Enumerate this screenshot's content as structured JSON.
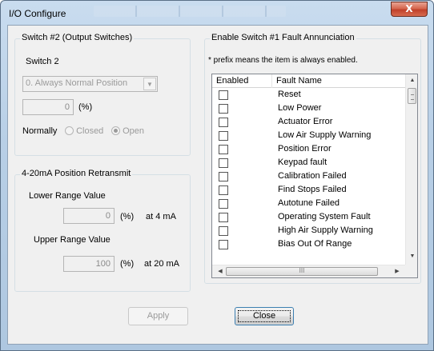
{
  "window": {
    "title": "I/O Configure",
    "close_glyph": "X"
  },
  "switch_group": {
    "legend": "Switch #2 (Output Switches)",
    "switch_label": "Switch 2",
    "mode_select": "0. Always Normal Position",
    "value": "0",
    "value_unit": "(%)",
    "normally_label": "Normally",
    "closed_label": "Closed",
    "open_label": "Open",
    "selected": "Open"
  },
  "retransmit_group": {
    "legend": "4-20mA Position Retransmit",
    "lower_label": "Lower Range Value",
    "lower_value": "0",
    "lower_unit": "(%)",
    "lower_suffix": "at 4 mA",
    "upper_label": "Upper Range Value",
    "upper_value": "100",
    "upper_unit": "(%)",
    "upper_suffix": "at 20 mA"
  },
  "fault_group": {
    "legend": "Enable Switch #1 Fault Annunciation",
    "note": "* prefix means the item is always enabled.",
    "columns": [
      "Enabled",
      "Fault Name"
    ],
    "rows": [
      {
        "name": "Reset",
        "enabled": false
      },
      {
        "name": "Low Power",
        "enabled": false
      },
      {
        "name": "Actuator Error",
        "enabled": false
      },
      {
        "name": "Low Air Supply Warning",
        "enabled": false
      },
      {
        "name": "Position Error",
        "enabled": false
      },
      {
        "name": "Keypad fault",
        "enabled": false
      },
      {
        "name": "Calibration Failed",
        "enabled": false
      },
      {
        "name": "Find Stops Failed",
        "enabled": false
      },
      {
        "name": "Autotune Failed",
        "enabled": false
      },
      {
        "name": "Operating System Fault",
        "enabled": false
      },
      {
        "name": "High Air Supply Warning",
        "enabled": false
      },
      {
        "name": "Bias Out Of Range",
        "enabled": false
      }
    ],
    "hscroll_grip": "III"
  },
  "buttons": {
    "apply": "Apply",
    "close": "Close"
  },
  "icons": {
    "close": "close-icon",
    "dropdown": "chevron-down-icon"
  },
  "colors": {
    "titlebar": "#b8cfe6",
    "close_button": "#c0412a",
    "client": "#f0f0f0",
    "disabled_text": "#9a9a9a"
  }
}
